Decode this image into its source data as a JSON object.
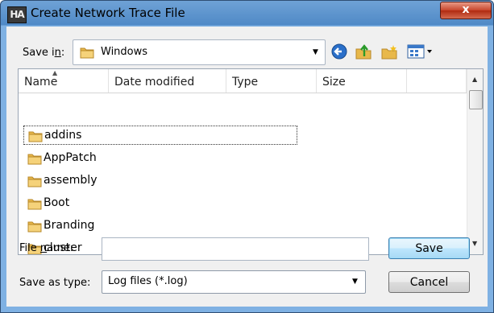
{
  "window": {
    "title": "Create Network Trace File",
    "app_icon_text": "HA",
    "close_glyph": "x"
  },
  "toolbar": {
    "save_in_label_a": "Save i",
    "save_in_label_u": "n",
    "save_in_label_b": ":",
    "save_in_value": "Windows",
    "icons": [
      "back-icon",
      "up-folder-icon",
      "new-folder-icon",
      "view-menu-icon"
    ]
  },
  "file_list": {
    "columns": [
      "Name",
      "Date modified",
      "Type",
      "Size"
    ],
    "rows": [
      {
        "name": "addins"
      },
      {
        "name": "AppPatch"
      },
      {
        "name": "assembly"
      },
      {
        "name": "Boot"
      },
      {
        "name": "Branding"
      },
      {
        "name": "cluster"
      }
    ]
  },
  "form": {
    "file_name_label_a": "File ",
    "file_name_label_u": "n",
    "file_name_label_b": "ame:",
    "file_name_value": "",
    "save_type_label": "Save as type:",
    "save_type_value": "Log files (*.log)"
  },
  "buttons": {
    "save": "Save",
    "cancel": "Cancel"
  },
  "colors": {
    "title_bar": "#4f89c6",
    "close_button": "#c7452b",
    "default_button": "#3c7fb1",
    "folder": "#e8b84a"
  }
}
